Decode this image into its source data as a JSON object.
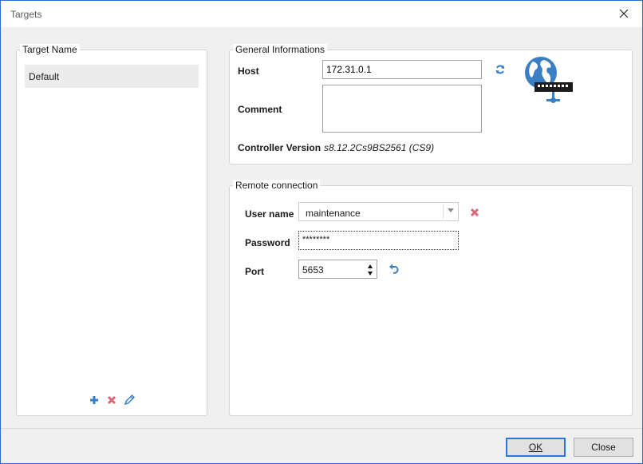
{
  "window": {
    "title": "Targets"
  },
  "target_list": {
    "legend": "Target Name",
    "items": [
      "Default"
    ]
  },
  "general": {
    "legend": "General Informations",
    "host_label": "Host",
    "host_value": "172.31.0.1",
    "comment_label": "Comment",
    "comment_value": "",
    "version_label": "Controller Version",
    "version_value": "s8.12.2Cs9BS2561 (CS9)"
  },
  "remote": {
    "legend": "Remote connection",
    "user_label": "User name",
    "user_value": "maintenance",
    "password_label": "Password",
    "password_value": "********",
    "port_label": "Port",
    "port_value": "5653"
  },
  "footer": {
    "ok_label": "OK",
    "close_label": "Close"
  },
  "colors": {
    "accent_blue": "#2b6ec8",
    "delete_red": "#d9687a",
    "icon_blue": "#3a7fc4"
  }
}
